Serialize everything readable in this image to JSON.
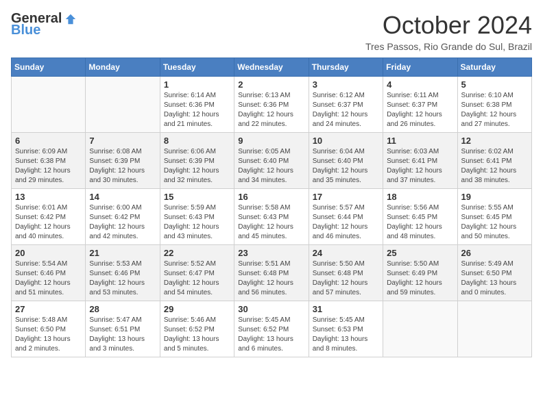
{
  "header": {
    "logo_general": "General",
    "logo_blue": "Blue",
    "title": "October 2024",
    "subtitle": "Tres Passos, Rio Grande do Sul, Brazil"
  },
  "days_of_week": [
    "Sunday",
    "Monday",
    "Tuesday",
    "Wednesday",
    "Thursday",
    "Friday",
    "Saturday"
  ],
  "weeks": [
    [
      {
        "day": "",
        "info": ""
      },
      {
        "day": "",
        "info": ""
      },
      {
        "day": "1",
        "info": "Sunrise: 6:14 AM\nSunset: 6:36 PM\nDaylight: 12 hours and 21 minutes."
      },
      {
        "day": "2",
        "info": "Sunrise: 6:13 AM\nSunset: 6:36 PM\nDaylight: 12 hours and 22 minutes."
      },
      {
        "day": "3",
        "info": "Sunrise: 6:12 AM\nSunset: 6:37 PM\nDaylight: 12 hours and 24 minutes."
      },
      {
        "day": "4",
        "info": "Sunrise: 6:11 AM\nSunset: 6:37 PM\nDaylight: 12 hours and 26 minutes."
      },
      {
        "day": "5",
        "info": "Sunrise: 6:10 AM\nSunset: 6:38 PM\nDaylight: 12 hours and 27 minutes."
      }
    ],
    [
      {
        "day": "6",
        "info": "Sunrise: 6:09 AM\nSunset: 6:38 PM\nDaylight: 12 hours and 29 minutes."
      },
      {
        "day": "7",
        "info": "Sunrise: 6:08 AM\nSunset: 6:39 PM\nDaylight: 12 hours and 30 minutes."
      },
      {
        "day": "8",
        "info": "Sunrise: 6:06 AM\nSunset: 6:39 PM\nDaylight: 12 hours and 32 minutes."
      },
      {
        "day": "9",
        "info": "Sunrise: 6:05 AM\nSunset: 6:40 PM\nDaylight: 12 hours and 34 minutes."
      },
      {
        "day": "10",
        "info": "Sunrise: 6:04 AM\nSunset: 6:40 PM\nDaylight: 12 hours and 35 minutes."
      },
      {
        "day": "11",
        "info": "Sunrise: 6:03 AM\nSunset: 6:41 PM\nDaylight: 12 hours and 37 minutes."
      },
      {
        "day": "12",
        "info": "Sunrise: 6:02 AM\nSunset: 6:41 PM\nDaylight: 12 hours and 38 minutes."
      }
    ],
    [
      {
        "day": "13",
        "info": "Sunrise: 6:01 AM\nSunset: 6:42 PM\nDaylight: 12 hours and 40 minutes."
      },
      {
        "day": "14",
        "info": "Sunrise: 6:00 AM\nSunset: 6:42 PM\nDaylight: 12 hours and 42 minutes."
      },
      {
        "day": "15",
        "info": "Sunrise: 5:59 AM\nSunset: 6:43 PM\nDaylight: 12 hours and 43 minutes."
      },
      {
        "day": "16",
        "info": "Sunrise: 5:58 AM\nSunset: 6:43 PM\nDaylight: 12 hours and 45 minutes."
      },
      {
        "day": "17",
        "info": "Sunrise: 5:57 AM\nSunset: 6:44 PM\nDaylight: 12 hours and 46 minutes."
      },
      {
        "day": "18",
        "info": "Sunrise: 5:56 AM\nSunset: 6:45 PM\nDaylight: 12 hours and 48 minutes."
      },
      {
        "day": "19",
        "info": "Sunrise: 5:55 AM\nSunset: 6:45 PM\nDaylight: 12 hours and 50 minutes."
      }
    ],
    [
      {
        "day": "20",
        "info": "Sunrise: 5:54 AM\nSunset: 6:46 PM\nDaylight: 12 hours and 51 minutes."
      },
      {
        "day": "21",
        "info": "Sunrise: 5:53 AM\nSunset: 6:46 PM\nDaylight: 12 hours and 53 minutes."
      },
      {
        "day": "22",
        "info": "Sunrise: 5:52 AM\nSunset: 6:47 PM\nDaylight: 12 hours and 54 minutes."
      },
      {
        "day": "23",
        "info": "Sunrise: 5:51 AM\nSunset: 6:48 PM\nDaylight: 12 hours and 56 minutes."
      },
      {
        "day": "24",
        "info": "Sunrise: 5:50 AM\nSunset: 6:48 PM\nDaylight: 12 hours and 57 minutes."
      },
      {
        "day": "25",
        "info": "Sunrise: 5:50 AM\nSunset: 6:49 PM\nDaylight: 12 hours and 59 minutes."
      },
      {
        "day": "26",
        "info": "Sunrise: 5:49 AM\nSunset: 6:50 PM\nDaylight: 13 hours and 0 minutes."
      }
    ],
    [
      {
        "day": "27",
        "info": "Sunrise: 5:48 AM\nSunset: 6:50 PM\nDaylight: 13 hours and 2 minutes."
      },
      {
        "day": "28",
        "info": "Sunrise: 5:47 AM\nSunset: 6:51 PM\nDaylight: 13 hours and 3 minutes."
      },
      {
        "day": "29",
        "info": "Sunrise: 5:46 AM\nSunset: 6:52 PM\nDaylight: 13 hours and 5 minutes."
      },
      {
        "day": "30",
        "info": "Sunrise: 5:45 AM\nSunset: 6:52 PM\nDaylight: 13 hours and 6 minutes."
      },
      {
        "day": "31",
        "info": "Sunrise: 5:45 AM\nSunset: 6:53 PM\nDaylight: 13 hours and 8 minutes."
      },
      {
        "day": "",
        "info": ""
      },
      {
        "day": "",
        "info": ""
      }
    ]
  ]
}
